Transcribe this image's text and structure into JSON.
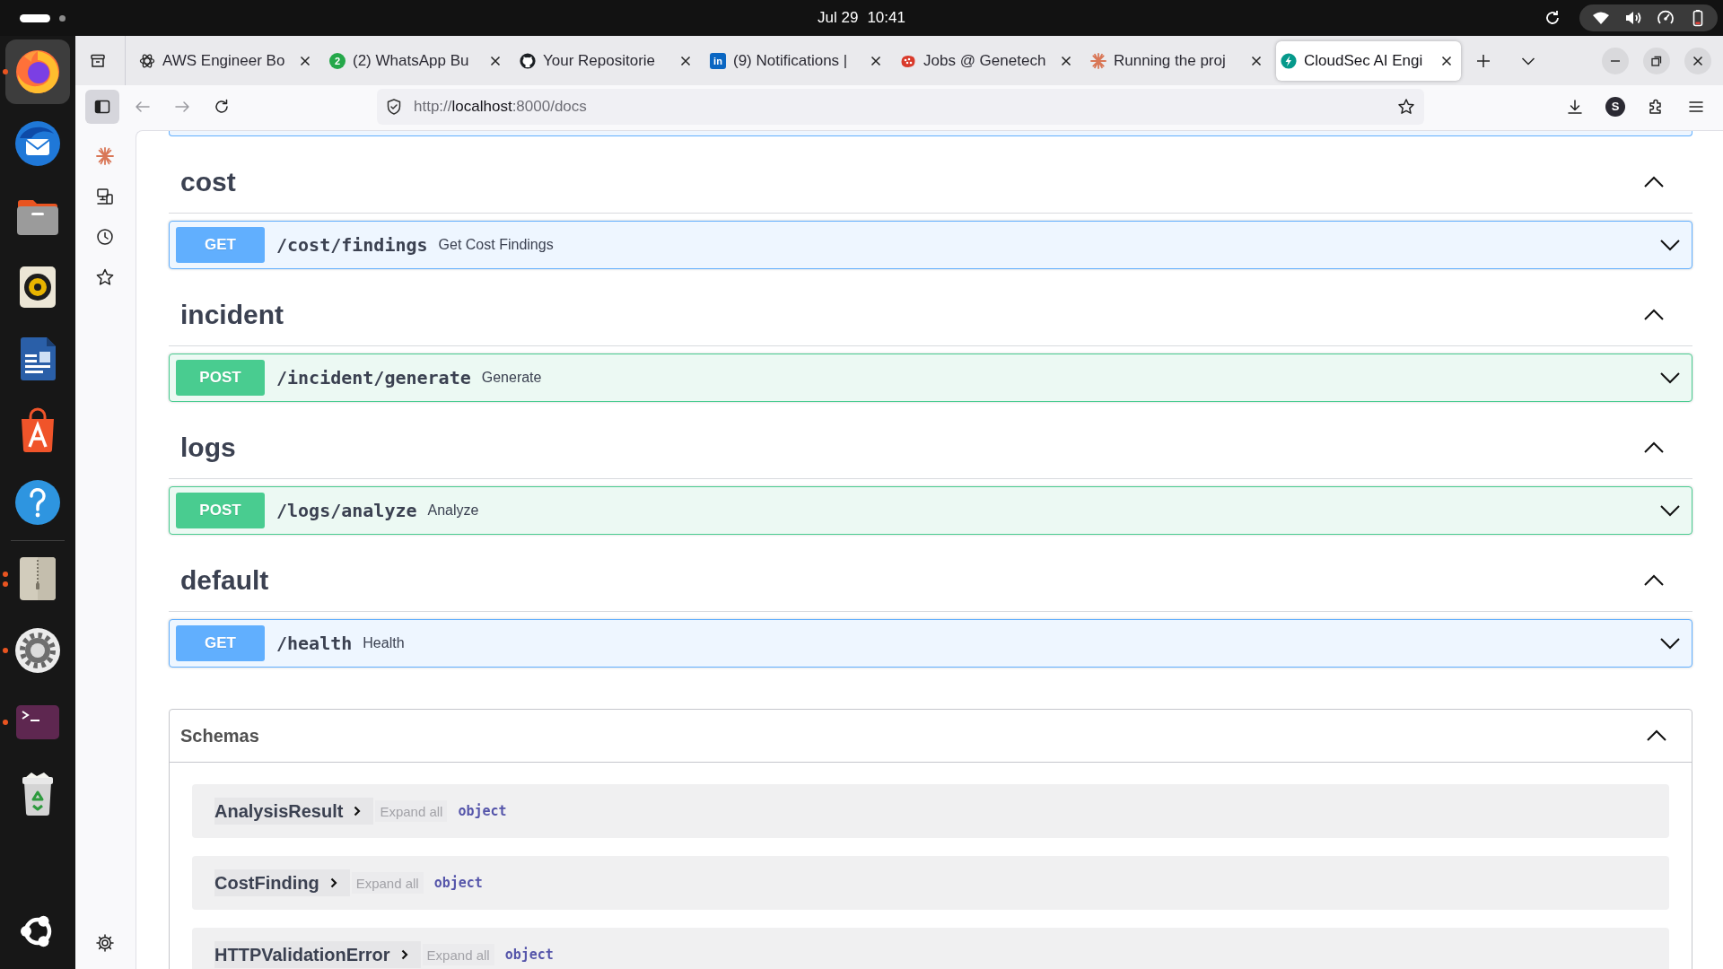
{
  "top_bar": {
    "date": "Jul 29",
    "time": "10:41"
  },
  "dock": {
    "favorites": [
      {
        "kind": "browser",
        "selected": true,
        "running": true,
        "multiple": false
      },
      {
        "kind": "mail",
        "selected": false,
        "running": false,
        "multiple": false
      },
      {
        "kind": "files",
        "selected": false,
        "running": false,
        "multiple": false
      },
      {
        "kind": "music",
        "selected": false,
        "running": false,
        "multiple": false
      },
      {
        "kind": "writer",
        "selected": false,
        "running": false,
        "multiple": false
      },
      {
        "kind": "store",
        "selected": false,
        "running": false,
        "multiple": false
      },
      {
        "kind": "help",
        "selected": false,
        "running": false,
        "multiple": false
      }
    ],
    "others": [
      {
        "kind": "archive",
        "selected": false,
        "running": true,
        "multiple": true
      },
      {
        "kind": "settings",
        "selected": false,
        "running": true,
        "multiple": false
      },
      {
        "kind": "terminal",
        "selected": false,
        "running": true,
        "multiple": false
      },
      {
        "kind": "trash",
        "selected": false,
        "running": false,
        "multiple": false
      }
    ]
  },
  "browser": {
    "tabs": [
      {
        "kind": "knot",
        "title": "AWS Engineer Bo",
        "selected": false
      },
      {
        "kind": "chat",
        "badge": "2",
        "title": "(2) WhatsApp Bu",
        "selected": false
      },
      {
        "kind": "cat",
        "title": "Your Repositorie",
        "selected": false
      },
      {
        "kind": "square",
        "badge": "in",
        "title": "(9) Notifications |",
        "selected": false
      },
      {
        "kind": "blob",
        "title": "Jobs @ Genetech",
        "selected": false
      },
      {
        "kind": "starburst",
        "title": "Running the proj",
        "selected": false
      },
      {
        "kind": "bolt",
        "title": "CloudSec AI Engi",
        "selected": true
      }
    ],
    "nav": {
      "sidebar_button": {
        "selected": true
      },
      "back": {
        "disabled": true
      },
      "forward": {
        "disabled": true
      },
      "url": "http://**localhost**:8000/docs",
      "account": {
        "initial": "S"
      }
    },
    "docs": {
      "sections": [
        {
          "tag": "cost",
          "expanded": true,
          "operations": [
            {
              "kind": "get",
              "method": "GET",
              "path": "/cost/findings",
              "summary": "Get Cost Findings",
              "expanded": false
            }
          ]
        },
        {
          "tag": "incident",
          "expanded": true,
          "operations": [
            {
              "kind": "post",
              "method": "POST",
              "path": "/incident/generate",
              "summary": "Generate",
              "expanded": false
            }
          ]
        },
        {
          "tag": "logs",
          "expanded": true,
          "operations": [
            {
              "kind": "post",
              "method": "POST",
              "path": "/logs/analyze",
              "summary": "Analyze",
              "expanded": false
            }
          ]
        },
        {
          "tag": "default",
          "expanded": true,
          "operations": [
            {
              "kind": "get",
              "method": "GET",
              "path": "/health",
              "summary": "Health",
              "expanded": false
            }
          ]
        }
      ],
      "schemas": {
        "title": "Schemas",
        "expanded": true,
        "models": [
          {
            "name": "AnalysisResult",
            "expanded": false,
            "expand_label": "Expand all",
            "type": "object"
          },
          {
            "name": "CostFinding",
            "expanded": false,
            "expand_label": "Expand all",
            "type": "object"
          },
          {
            "name": "HTTPValidationError",
            "expanded": false,
            "expand_label": "Expand all",
            "type": "object"
          }
        ]
      }
    }
  }
}
